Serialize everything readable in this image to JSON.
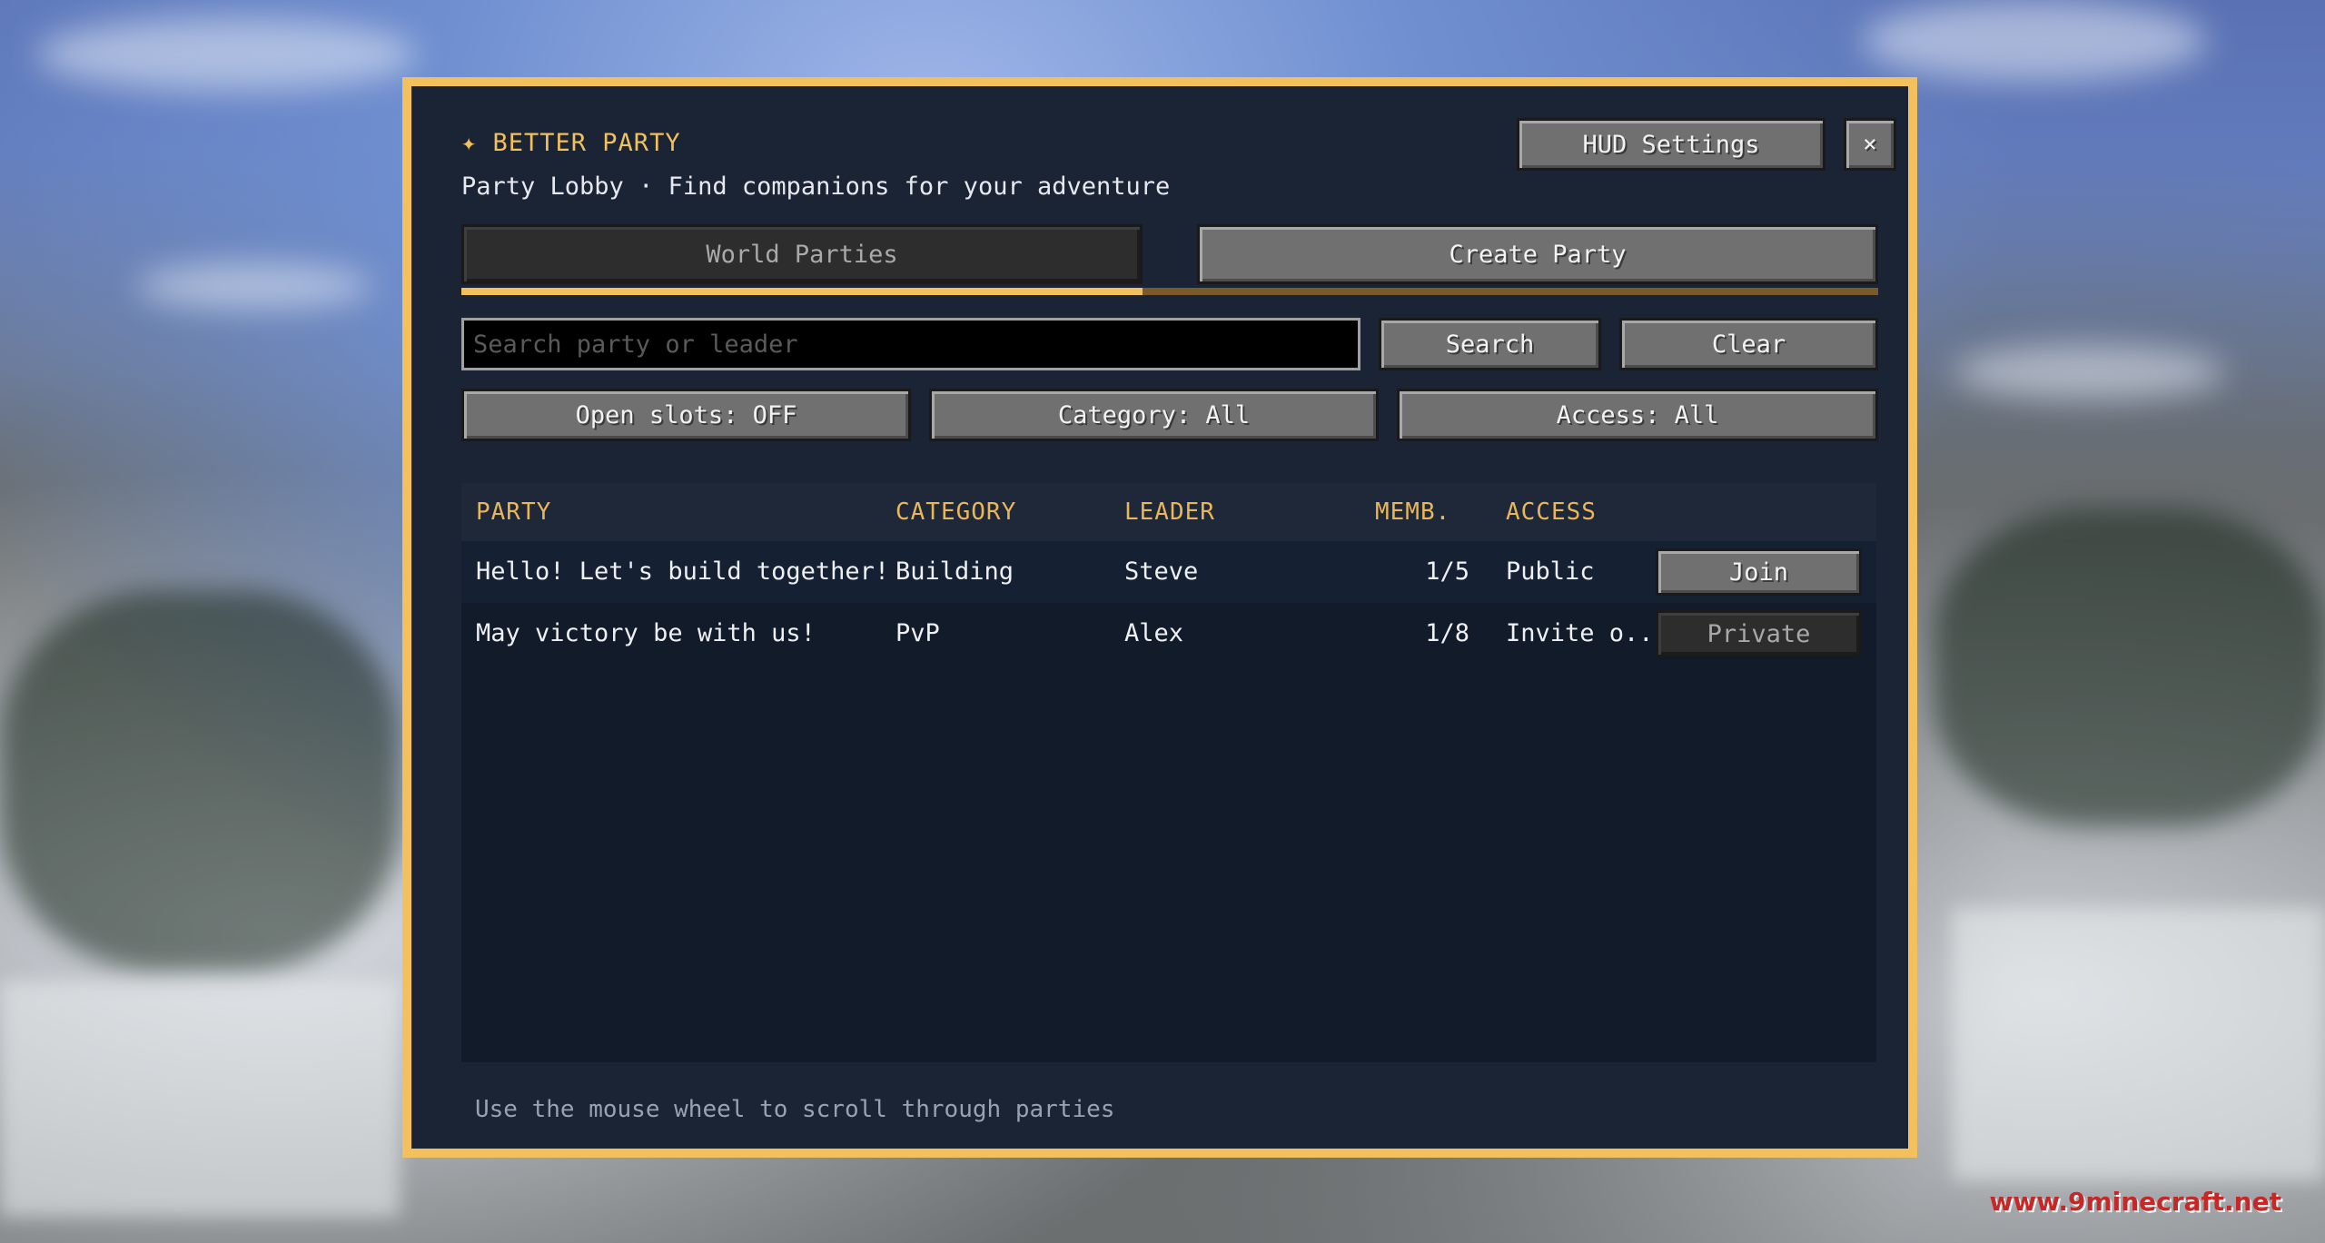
{
  "app": {
    "brand": "✦ BETTER PARTY",
    "subtitle": "Party Lobby · Find companions for your adventure"
  },
  "header": {
    "hud_settings_label": "HUD Settings",
    "close_label": "×"
  },
  "tabs": [
    {
      "label": "World Parties",
      "selected": true
    },
    {
      "label": "Create Party",
      "selected": false
    }
  ],
  "search": {
    "placeholder": "Search party or leader",
    "value": "",
    "search_label": "Search",
    "clear_label": "Clear"
  },
  "filters": {
    "open_slots": "Open slots: OFF",
    "category": "Category: All",
    "access": "Access: All"
  },
  "table": {
    "columns": [
      "PARTY",
      "CATEGORY",
      "LEADER",
      "MEMB.",
      "ACCESS"
    ],
    "rows": [
      {
        "party": "Hello! Let's build together!",
        "category": "Building",
        "leader": "Steve",
        "members": "1/5",
        "access": "Public",
        "action": "Join",
        "action_enabled": true
      },
      {
        "party": "May victory be with us!",
        "category": "PvP",
        "leader": "Alex",
        "members": "1/8",
        "access": "Invite o...",
        "action": "Private",
        "action_enabled": false
      }
    ]
  },
  "footer": {
    "hint": "Use the mouse wheel to scroll through parties"
  },
  "watermark": "www.9minecraft.net",
  "colors": {
    "accent": "#f2c05c",
    "panel_bg": "#1a2435",
    "header_text": "#e9b659"
  }
}
